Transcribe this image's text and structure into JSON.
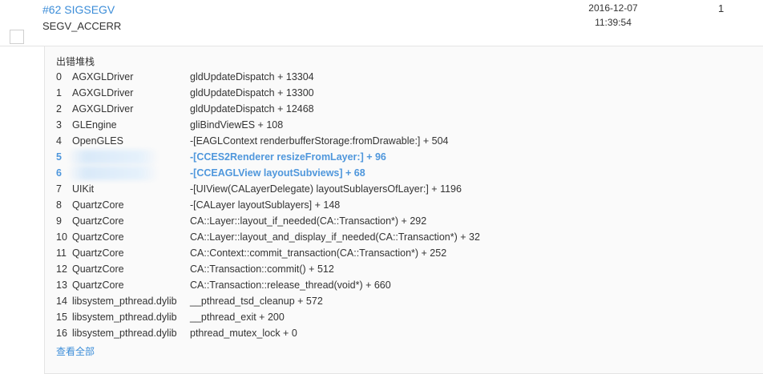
{
  "issue": {
    "title": "#62 SIGSEGV",
    "subtitle": "SEGV_ACCERR",
    "date": "2016-12-07",
    "time": "11:39:54",
    "count": "1"
  },
  "stack": {
    "heading": "出错堆栈",
    "view_all_label": "查看全部",
    "highlight_color": "#4f97dc",
    "frames": [
      {
        "index": "0",
        "library": "AGXGLDriver",
        "symbol": "gldUpdateDispatch + 13304"
      },
      {
        "index": "1",
        "library": "AGXGLDriver",
        "symbol": "gldUpdateDispatch + 13300"
      },
      {
        "index": "2",
        "library": "AGXGLDriver",
        "symbol": "gldUpdateDispatch + 12468"
      },
      {
        "index": "3",
        "library": "GLEngine",
        "symbol": "gliBindViewES + 108"
      },
      {
        "index": "4",
        "library": "OpenGLES",
        "symbol": "-[EAGLContext renderbufferStorage:fromDrawable:] + 504"
      },
      {
        "index": "5",
        "library": "",
        "symbol": "-[CCES2Renderer resizeFromLayer:] + 96"
      },
      {
        "index": "6",
        "library": "",
        "symbol": "-[CCEAGLView layoutSubviews] + 68"
      },
      {
        "index": "7",
        "library": "UIKit",
        "symbol": "-[UIView(CALayerDelegate) layoutSublayersOfLayer:] + 1196"
      },
      {
        "index": "8",
        "library": "QuartzCore",
        "symbol": "-[CALayer layoutSublayers] + 148"
      },
      {
        "index": "9",
        "library": "QuartzCore",
        "symbol": "CA::Layer::layout_if_needed(CA::Transaction*) + 292"
      },
      {
        "index": "10",
        "library": "QuartzCore",
        "symbol": "CA::Layer::layout_and_display_if_needed(CA::Transaction*) + 32"
      },
      {
        "index": "11",
        "library": "QuartzCore",
        "symbol": "CA::Context::commit_transaction(CA::Transaction*) + 252"
      },
      {
        "index": "12",
        "library": "QuartzCore",
        "symbol": "CA::Transaction::commit() + 512"
      },
      {
        "index": "13",
        "library": "QuartzCore",
        "symbol": "CA::Transaction::release_thread(void*) + 660"
      },
      {
        "index": "14",
        "library": "libsystem_pthread.dylib",
        "symbol": "__pthread_tsd_cleanup + 572"
      },
      {
        "index": "15",
        "library": "libsystem_pthread.dylib",
        "symbol": "__pthread_exit + 200"
      },
      {
        "index": "16",
        "library": "libsystem_pthread.dylib",
        "symbol": "pthread_mutex_lock + 0"
      }
    ]
  }
}
